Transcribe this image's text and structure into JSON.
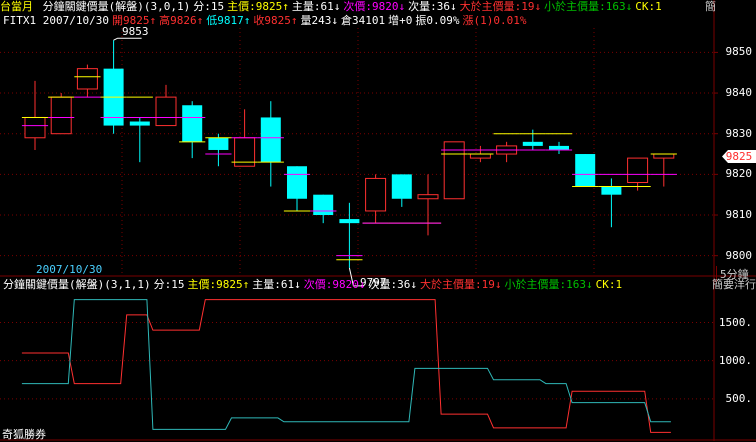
{
  "header": {
    "symbol": "台當月",
    "info_segments": [
      {
        "text": "分鐘關鍵價量(解盤)(3,0,1)",
        "color": "#ffffff"
      },
      {
        "text": "分:15",
        "color": "#ffffff"
      },
      {
        "text": "主價:9825↑",
        "color": "#ffff00"
      },
      {
        "text": "主量:61↓",
        "color": "#ffffff"
      },
      {
        "text": "次價:9820↓",
        "color": "#ff00ff"
      },
      {
        "text": "次量:36↓",
        "color": "#ffffff"
      },
      {
        "text": "大於主價量:19↓",
        "color": "#ff3030"
      },
      {
        "text": "小於主價量:163↓",
        "color": "#00c000"
      },
      {
        "text": "CK:1",
        "color": "#ffff00"
      }
    ],
    "right_label": "簡"
  },
  "quote": {
    "segments": [
      {
        "text": "FITX1 2007/10/30",
        "color": "#ffffff"
      },
      {
        "text": "開9825↑",
        "color": "#ff3030"
      },
      {
        "text": "高9826↑",
        "color": "#ff3030"
      },
      {
        "text": "低9817↑",
        "color": "#00ffff"
      },
      {
        "text": "收9825↑",
        "color": "#ff3030"
      },
      {
        "text": "量243↓",
        "color": "#ffffff"
      },
      {
        "text": "倉34101",
        "color": "#ffffff"
      },
      {
        "text": "增+0",
        "color": "#ffffff"
      },
      {
        "text": "振0.09%",
        "color": "#ffffff"
      },
      {
        "text": "漲(1)0.01%",
        "color": "#ff3030"
      }
    ]
  },
  "price_axis": {
    "ticks": [
      "9850",
      "9840",
      "9830",
      "9820",
      "9810",
      "9800"
    ],
    "current_price": "9825"
  },
  "annotations": {
    "high_label": "9853",
    "low_label": "9797"
  },
  "date_label": "2007/10/30",
  "timeframe": "5分鐘",
  "indicator": {
    "segments": [
      {
        "text": "分鐘關鍵價量(解盤)(3,1,1)",
        "color": "#ffffff"
      },
      {
        "text": "分:15",
        "color": "#ffffff"
      },
      {
        "text": "主價:9825↑",
        "color": "#ffff00"
      },
      {
        "text": "主量:61↓",
        "color": "#ffffff"
      },
      {
        "text": "次價:9820↓",
        "color": "#ff00ff"
      },
      {
        "text": "次量:36↓",
        "color": "#ffffff"
      },
      {
        "text": "大於主價量:19↓",
        "color": "#ff3030"
      },
      {
        "text": "小於主價量:163↓",
        "color": "#00c000"
      },
      {
        "text": "CK:1",
        "color": "#ffff00"
      }
    ],
    "right_label": "簡要洋行",
    "ticks": [
      "1500.",
      "1000.",
      "500."
    ]
  },
  "footer": {
    "brand": "奇狐勝券"
  },
  "colors": {
    "up": "#ff3030",
    "down": "#00ffff",
    "grid": "#7a0000",
    "main_price": "#ffff00",
    "second_price": "#ff00ff"
  },
  "chart_data": {
    "type": "candlestick",
    "price_range": [
      9795,
      9856
    ],
    "candles": [
      {
        "o": 9829,
        "h": 9843,
        "l": 9826,
        "c": 9834,
        "main": 9834,
        "second": 9832
      },
      {
        "o": 9830,
        "h": 9840,
        "l": 9830,
        "c": 9839,
        "main": 9839,
        "second": 9834
      },
      {
        "o": 9841,
        "h": 9847,
        "l": 9839,
        "c": 9846,
        "main": 9844,
        "second": 9839
      },
      {
        "o": 9846,
        "h": 9853,
        "l": 9830,
        "c": 9832,
        "main": 9839,
        "second": 9834
      },
      {
        "o": 9833,
        "h": 9834,
        "l": 9823,
        "c": 9832,
        "main": 9839,
        "second": 9834
      },
      {
        "o": 9832,
        "h": 9842,
        "l": 9832,
        "c": 9839,
        "main": 9834,
        "second": 9834
      },
      {
        "o": 9837,
        "h": 9838,
        "l": 9824,
        "c": 9828,
        "main": 9828,
        "second": 9834
      },
      {
        "o": 9829,
        "h": 9830,
        "l": 9822,
        "c": 9826,
        "main": 9829,
        "second": 9825
      },
      {
        "o": 9822,
        "h": 9836,
        "l": 9822,
        "c": 9829,
        "main": 9823,
        "second": 9829
      },
      {
        "o": 9834,
        "h": 9838,
        "l": 9817,
        "c": 9823,
        "main": 9823,
        "second": 9829
      },
      {
        "o": 9822,
        "h": 9822,
        "l": 9811,
        "c": 9814,
        "main": 9811,
        "second": 9820
      },
      {
        "o": 9815,
        "h": 9815,
        "l": 9808,
        "c": 9810,
        "main": 9811,
        "second": 9811
      },
      {
        "o": 9809,
        "h": 9813,
        "l": 9797,
        "c": 9808,
        "main": 9799,
        "second": 9800
      },
      {
        "o": 9811,
        "h": 9820,
        "l": 9808,
        "c": 9819,
        "main": 9808,
        "second": 9808
      },
      {
        "o": 9820,
        "h": 9820,
        "l": 9812,
        "c": 9814,
        "main": 9808,
        "second": 9808
      },
      {
        "o": 9814,
        "h": 9820,
        "l": 9805,
        "c": 9815,
        "main": 9808,
        "second": 9808
      },
      {
        "o": 9814,
        "h": 9828,
        "l": 9814,
        "c": 9828,
        "main": 9825,
        "second": 9826
      },
      {
        "o": 9824,
        "h": 9827,
        "l": 9823,
        "c": 9825,
        "main": 9825,
        "second": 9826
      },
      {
        "o": 9825,
        "h": 9828,
        "l": 9823,
        "c": 9827,
        "main": 9830,
        "second": 9826
      },
      {
        "o": 9828,
        "h": 9831,
        "l": 9826,
        "c": 9827,
        "main": 9830,
        "second": 9826
      },
      {
        "o": 9827,
        "h": 9828,
        "l": 9825,
        "c": 9826,
        "main": 9830,
        "second": 9826
      },
      {
        "o": 9825,
        "h": 9825,
        "l": 9817,
        "c": 9817,
        "main": 9817,
        "second": 9820
      },
      {
        "o": 9817,
        "h": 9819,
        "l": 9807,
        "c": 9815,
        "main": 9817,
        "second": 9820
      },
      {
        "o": 9818,
        "h": 9823,
        "l": 9816,
        "c": 9824,
        "main": 9817,
        "second": 9820
      },
      {
        "o": 9824,
        "h": 9825,
        "l": 9817,
        "c": 9825,
        "main": 9825,
        "second": 9820
      }
    ],
    "indicator_range": [
      0,
      1900
    ],
    "indicator_series": [
      {
        "name": "大於主價量",
        "color": "#ff3030",
        "values": [
          1100,
          1100,
          700,
          700,
          1600,
          1400,
          1400,
          1800,
          1800,
          1800,
          1800,
          1800,
          1800,
          1800,
          1800,
          1800,
          300,
          300,
          120,
          120,
          120,
          600,
          600,
          600,
          60
        ]
      },
      {
        "name": "小於主價量",
        "color": "#2fb8b8",
        "values": [
          700,
          700,
          1800,
          1800,
          1800,
          100,
          100,
          100,
          250,
          250,
          200,
          200,
          200,
          200,
          200,
          900,
          900,
          900,
          750,
          750,
          700,
          450,
          450,
          450,
          200
        ]
      }
    ]
  }
}
